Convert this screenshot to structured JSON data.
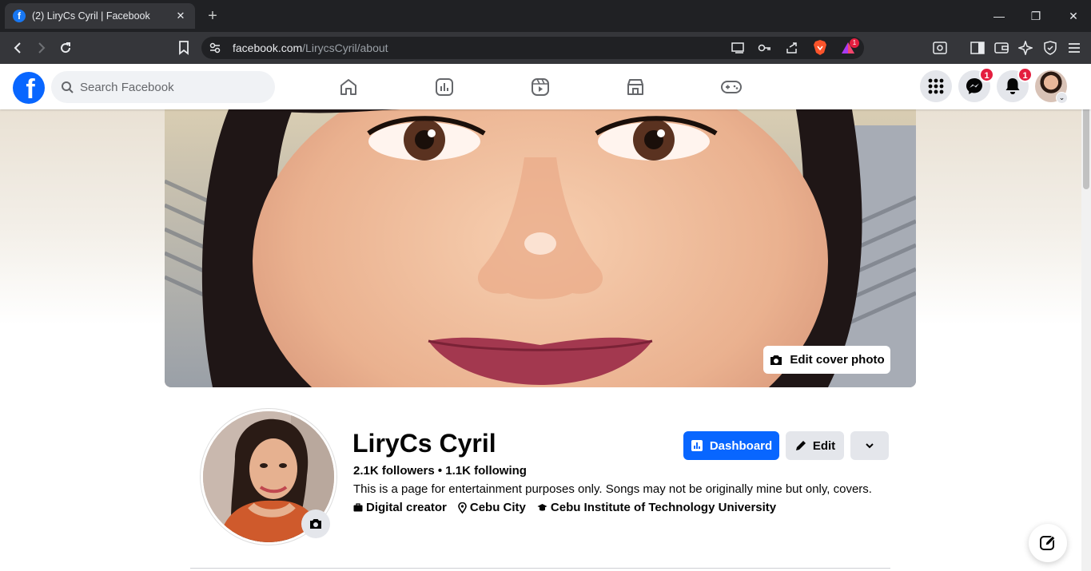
{
  "browser": {
    "tab_title": "(2) LiryCs Cyril | Facebook",
    "url_host": "facebook.com",
    "url_path": "/LirycsCyril/about",
    "extension_badge": "1"
  },
  "nav": {
    "search_placeholder": "Search Facebook",
    "messenger_badge": "1",
    "notifications_badge": "1"
  },
  "cover": {
    "edit_cover_label": "Edit cover photo"
  },
  "profile": {
    "name": "LiryCs Cyril",
    "stats": "2.1K followers • 1.1K following",
    "bio": "This is a page for entertainment purposes only. Songs may not be originally mine but only, covers.",
    "details": {
      "category": "Digital creator",
      "location": "Cebu City",
      "education": "Cebu Institute of Technology University"
    }
  },
  "actions": {
    "dashboard_label": "Dashboard",
    "edit_label": "Edit"
  },
  "colors": {
    "brand": "#0866ff",
    "badge": "#e41e3f",
    "button_secondary": "#e4e6eb"
  }
}
